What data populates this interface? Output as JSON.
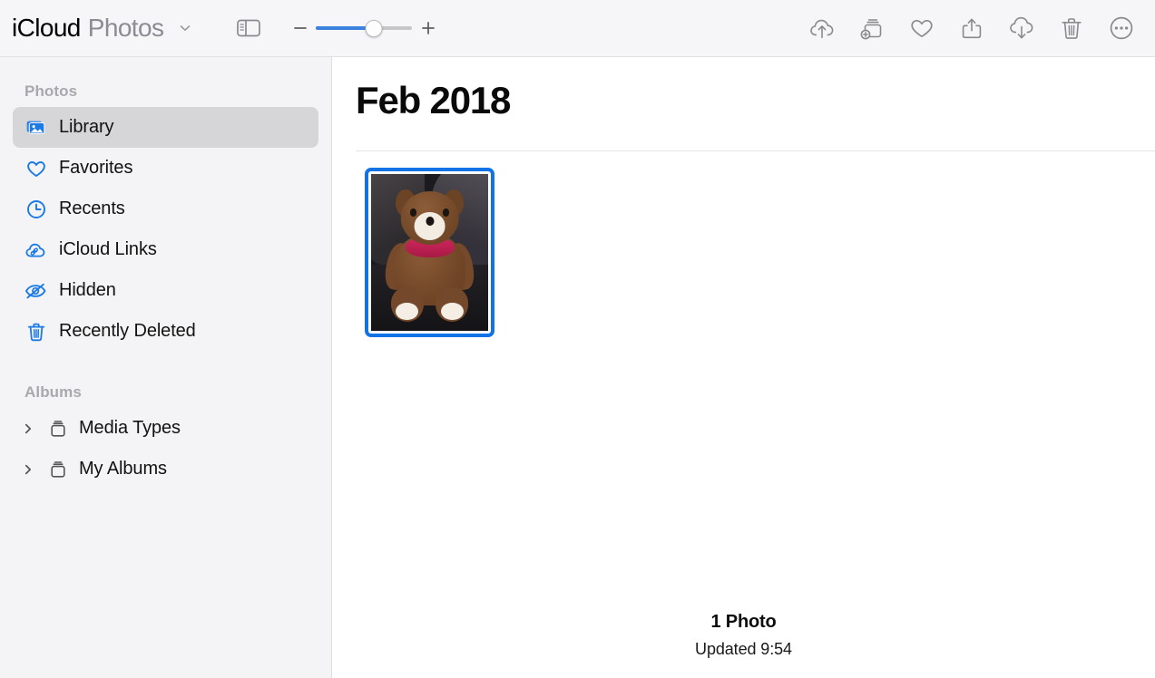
{
  "titlebar": {
    "brand": "iCloud",
    "suffix": "Photos",
    "chevron_icon": "chevron-down-icon",
    "sidebar_toggle_icon": "sidebar-toggle-icon",
    "zoom": {
      "minus_label": "−",
      "plus_label": "+",
      "value_percent": 60
    },
    "actions": [
      {
        "name": "upload-to-icloud-button",
        "icon": "cloud-upload-icon",
        "label": "Upload"
      },
      {
        "name": "add-to-album-button",
        "icon": "album-add-icon",
        "label": "Add to Album"
      },
      {
        "name": "favorite-button",
        "icon": "heart-icon",
        "label": "Favorite"
      },
      {
        "name": "share-button",
        "icon": "share-icon",
        "label": "Share"
      },
      {
        "name": "download-button",
        "icon": "cloud-download-icon",
        "label": "Download"
      },
      {
        "name": "delete-button",
        "icon": "trash-icon",
        "label": "Delete"
      },
      {
        "name": "more-options-button",
        "icon": "ellipsis-circle-icon",
        "label": "More"
      }
    ]
  },
  "sidebar": {
    "photos_section_title": "Photos",
    "photos_items": [
      {
        "label": "Library",
        "icon": "photo-stack-icon",
        "selected": true
      },
      {
        "label": "Favorites",
        "icon": "heart-icon",
        "selected": false
      },
      {
        "label": "Recents",
        "icon": "clock-icon",
        "selected": false
      },
      {
        "label": "iCloud Links",
        "icon": "cloud-link-icon",
        "selected": false
      },
      {
        "label": "Hidden",
        "icon": "eye-slash-icon",
        "selected": false
      },
      {
        "label": "Recently Deleted",
        "icon": "trash-icon",
        "selected": false
      }
    ],
    "albums_section_title": "Albums",
    "albums_items": [
      {
        "label": "Media Types",
        "icon": "album-box-icon",
        "disclosure": "chevron-right-icon"
      },
      {
        "label": "My Albums",
        "icon": "album-box-icon",
        "disclosure": "chevron-right-icon"
      }
    ]
  },
  "content": {
    "month_title": "Feb 2018",
    "photos": [
      {
        "name": "photo-thumbnail-teddy-bear",
        "alt": "Brown teddy bear with red scarf",
        "selected": true
      }
    ],
    "footer": {
      "photo_count": "1 Photo",
      "updated": "Updated 9:54"
    }
  },
  "colors": {
    "accent_blue": "#1273e6",
    "sidebar_icon_blue": "#1b7ae4",
    "toolbar_bg": "#f6f5f7",
    "sidebar_bg": "#f4f3f5",
    "selection_gray": "#d6d5d8",
    "slider_blue": "#3b82de"
  }
}
